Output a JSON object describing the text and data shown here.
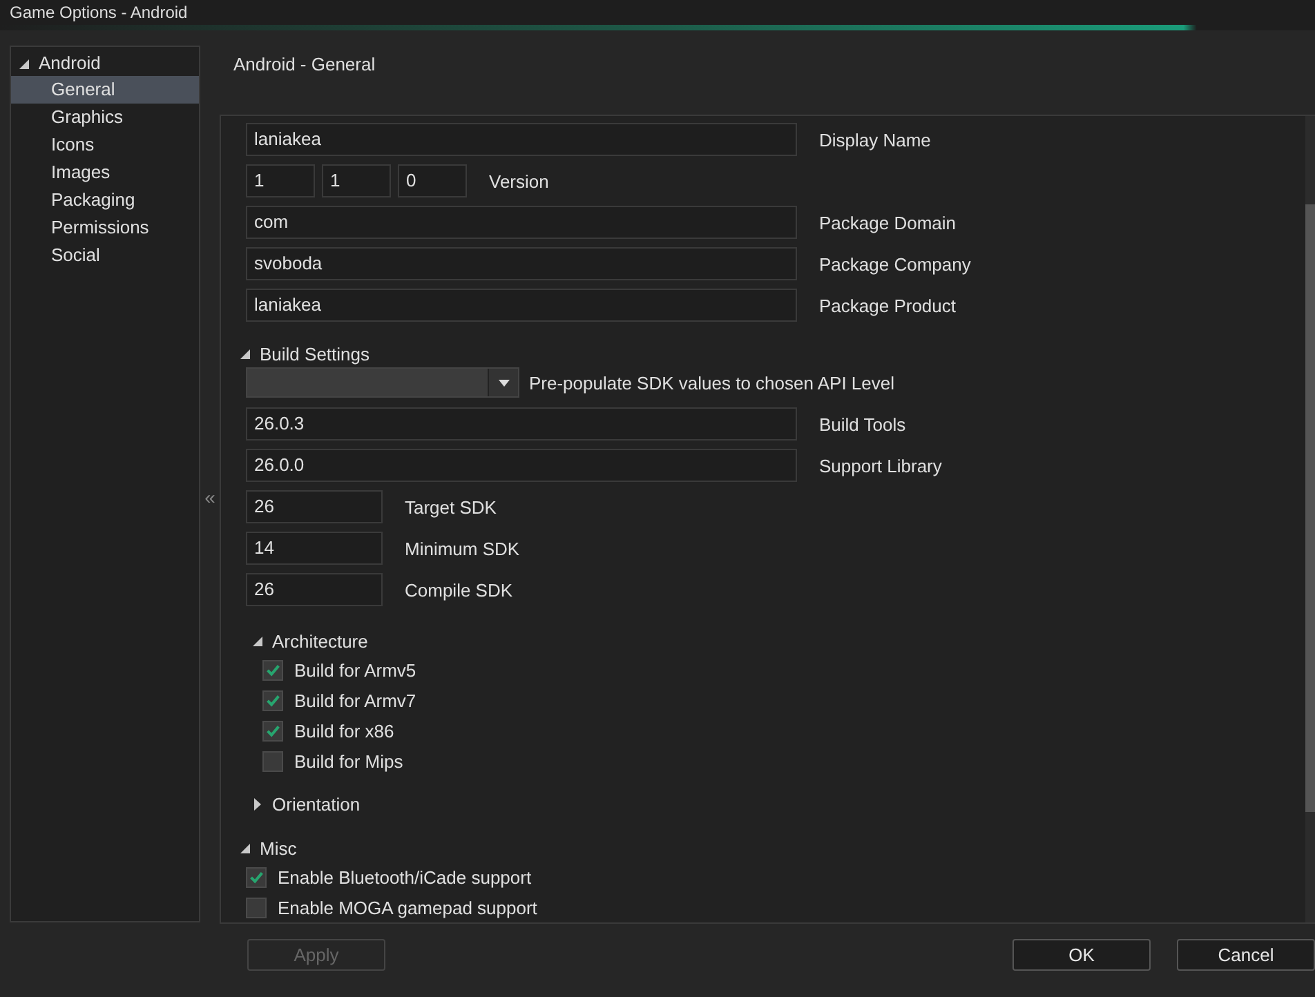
{
  "window": {
    "title": "Game Options - Android"
  },
  "sidebar": {
    "items": [
      {
        "label": "Android",
        "expanded": true,
        "selected": false,
        "children": [
          {
            "label": "General",
            "selected": true
          },
          {
            "label": "Graphics",
            "selected": false
          },
          {
            "label": "Icons",
            "selected": false
          },
          {
            "label": "Images",
            "selected": false
          },
          {
            "label": "Packaging",
            "selected": false
          },
          {
            "label": "Permissions",
            "selected": false
          },
          {
            "label": "Social",
            "selected": false
          }
        ]
      }
    ]
  },
  "collapse_toggle": "«",
  "page_title": "Android - General",
  "general": {
    "display_name": {
      "value": "laniakea",
      "label": "Display Name"
    },
    "version": {
      "values": [
        "1",
        "1",
        "0"
      ],
      "label": "Version"
    },
    "package": [
      {
        "value": "com",
        "label": "Package Domain"
      },
      {
        "value": "svoboda",
        "label": "Package Company"
      },
      {
        "value": "laniakea",
        "label": "Package Product"
      }
    ]
  },
  "build_settings": {
    "title": "Build Settings",
    "expanded": true,
    "api_level": {
      "label": "Pre-populate SDK values to chosen API Level"
    },
    "paths": [
      {
        "value": "26.0.3",
        "label": "Build Tools"
      },
      {
        "value": "26.0.0",
        "label": "Support Library"
      }
    ],
    "sdks": [
      {
        "value": "26",
        "label": "Target SDK"
      },
      {
        "value": "14",
        "label": "Minimum SDK"
      },
      {
        "value": "26",
        "label": "Compile SDK"
      }
    ],
    "architecture": {
      "title": "Architecture",
      "expanded": true,
      "options": [
        {
          "label": "Build for Armv5",
          "checked": true
        },
        {
          "label": "Build for Armv7",
          "checked": true
        },
        {
          "label": "Build for x86",
          "checked": true
        },
        {
          "label": "Build for Mips",
          "checked": false
        }
      ]
    },
    "orientation": {
      "title": "Orientation",
      "expanded": false
    }
  },
  "misc": {
    "title": "Misc",
    "expanded": true,
    "options": [
      {
        "label": "Enable Bluetooth/iCade support",
        "checked": true
      },
      {
        "label": "Enable MOGA gamepad support",
        "checked": false
      }
    ]
  },
  "buttons": [
    {
      "kind": "apply",
      "label": "Apply",
      "disabled": true
    },
    {
      "kind": "ok",
      "label": "OK",
      "disabled": false
    },
    {
      "kind": "cancel",
      "label": "Cancel",
      "disabled": false
    }
  ]
}
